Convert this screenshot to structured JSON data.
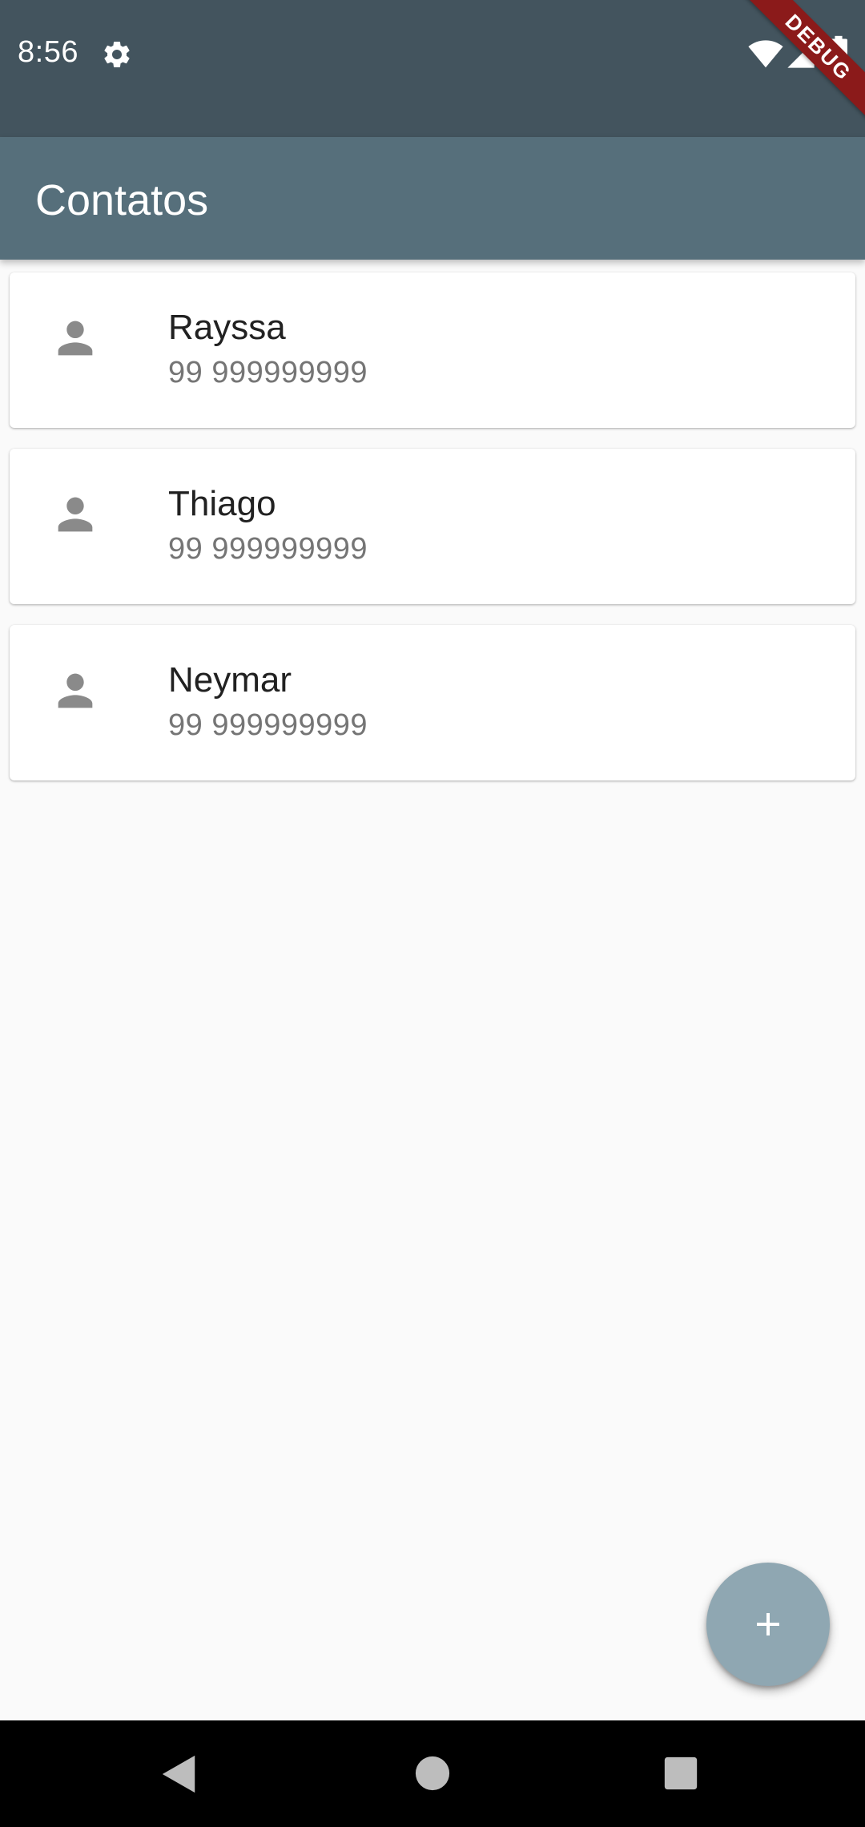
{
  "status_bar": {
    "time": "8:56",
    "icons": [
      "gear-icon",
      "wifi-icon",
      "signal-icon",
      "battery-icon"
    ]
  },
  "debug_banner": "DEBUG",
  "app_bar": {
    "title": "Contatos",
    "color": "#566f7b"
  },
  "contacts": [
    {
      "name": "Rayssa",
      "phone": "99 999999999",
      "icon": "person-icon"
    },
    {
      "name": "Thiago",
      "phone": "99 999999999",
      "icon": "person-icon"
    },
    {
      "name": "Neymar",
      "phone": "99 999999999",
      "icon": "person-icon"
    }
  ],
  "fab": {
    "icon": "plus-icon",
    "color": "#8fa7b2"
  },
  "nav_bar": {
    "icons": [
      "back-icon",
      "home-icon",
      "recents-icon"
    ]
  }
}
